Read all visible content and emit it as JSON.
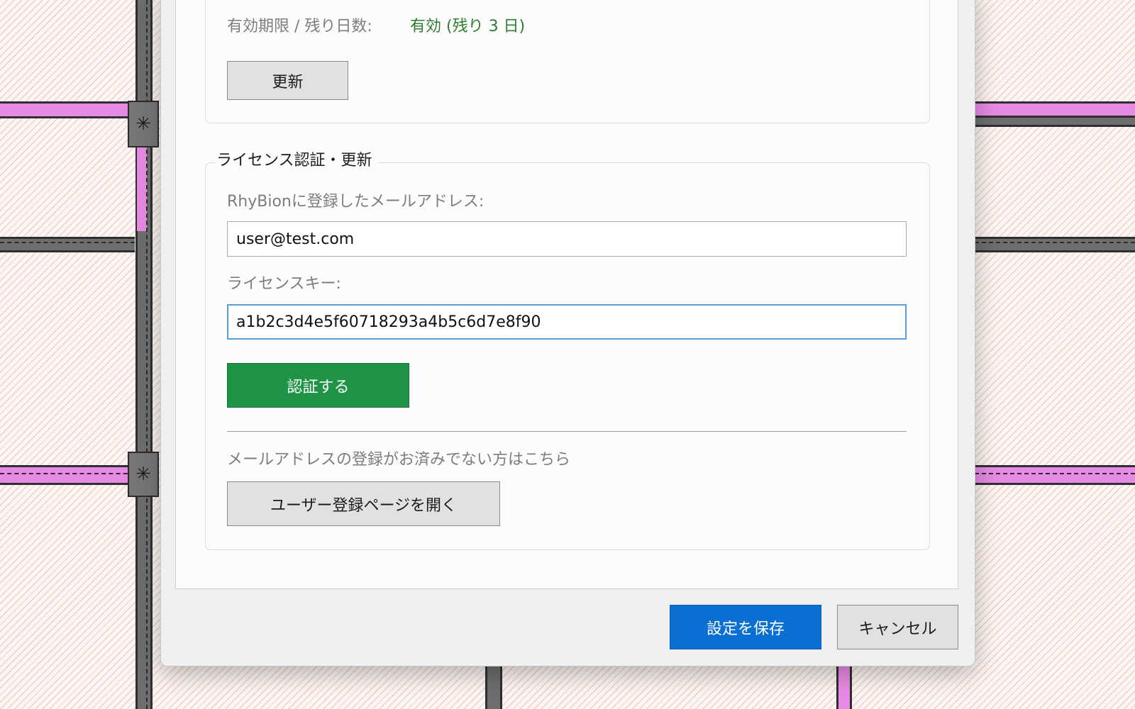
{
  "license_status": {
    "expiry_label": "有効期限 / 残り日数:",
    "expiry_value": "有効 (残り 3 日)",
    "refresh_button": "更新"
  },
  "license_auth": {
    "group_title": "ライセンス認証・更新",
    "email_label": "RhyBionに登録したメールアドレス:",
    "email_value": "user@test.com",
    "key_label": "ライセンスキー:",
    "key_value": "a1b2c3d4e5f60718293a4b5c6d7e8f90",
    "authenticate_button": "認証する",
    "register_hint": "メールアドレスの登録がお済みでない方はこちら",
    "open_register_button": "ユーザー登録ページを開く"
  },
  "footer": {
    "save_button": "設定を保存",
    "cancel_button": "キャンセル"
  },
  "colors": {
    "accent_blue": "#0a6fd3",
    "authenticate_green": "#1f9346",
    "status_green": "#2e7d32",
    "wall_pink": "#e78ae4"
  }
}
